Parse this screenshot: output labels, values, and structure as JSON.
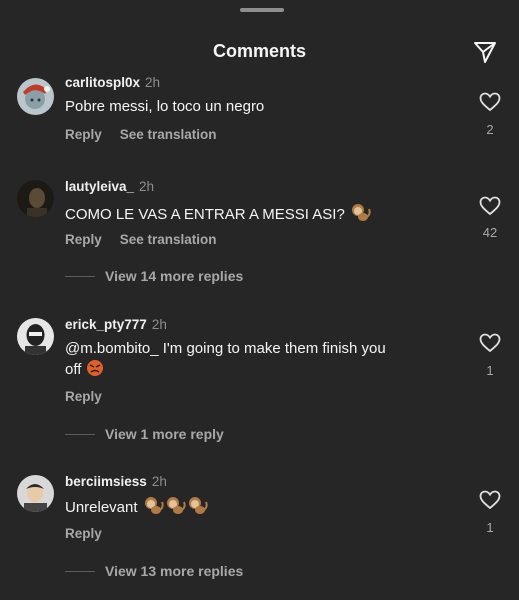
{
  "header": {
    "title": "Comments"
  },
  "comments": [
    {
      "username": "carlitospl0x",
      "time": "2h",
      "text": "Pobre messi, lo toco un negro",
      "reply_label": "Reply",
      "translate_label": "See translation",
      "likes": "2"
    },
    {
      "username": "lautyleiva_",
      "time": "2h",
      "text": "COMO LE VAS A ENTRAR A MESSI ASI?",
      "reply_label": "Reply",
      "translate_label": "See translation",
      "likes": "42",
      "more_replies": "View 14 more replies"
    },
    {
      "username": "erick_pty777",
      "time": "2h",
      "text_line1": "@m.bombito_  I'm going to make them finish you",
      "text_line2": "off",
      "reply_label": "Reply",
      "likes": "1",
      "more_replies": "View 1 more reply"
    },
    {
      "username": "berciimsiess",
      "time": "2h",
      "text": "Unrelevant",
      "reply_label": "Reply",
      "likes": "1",
      "more_replies": "View 13 more replies"
    }
  ],
  "icons": {
    "send": "send-icon",
    "like": "heart-outline-icon",
    "monkey": "monkey-emoji",
    "angry": "angry-face-emoji"
  },
  "colors": {
    "background": "#262626",
    "secondary_text": "#a8a8a8",
    "primary_text": "#f5f5f5"
  }
}
